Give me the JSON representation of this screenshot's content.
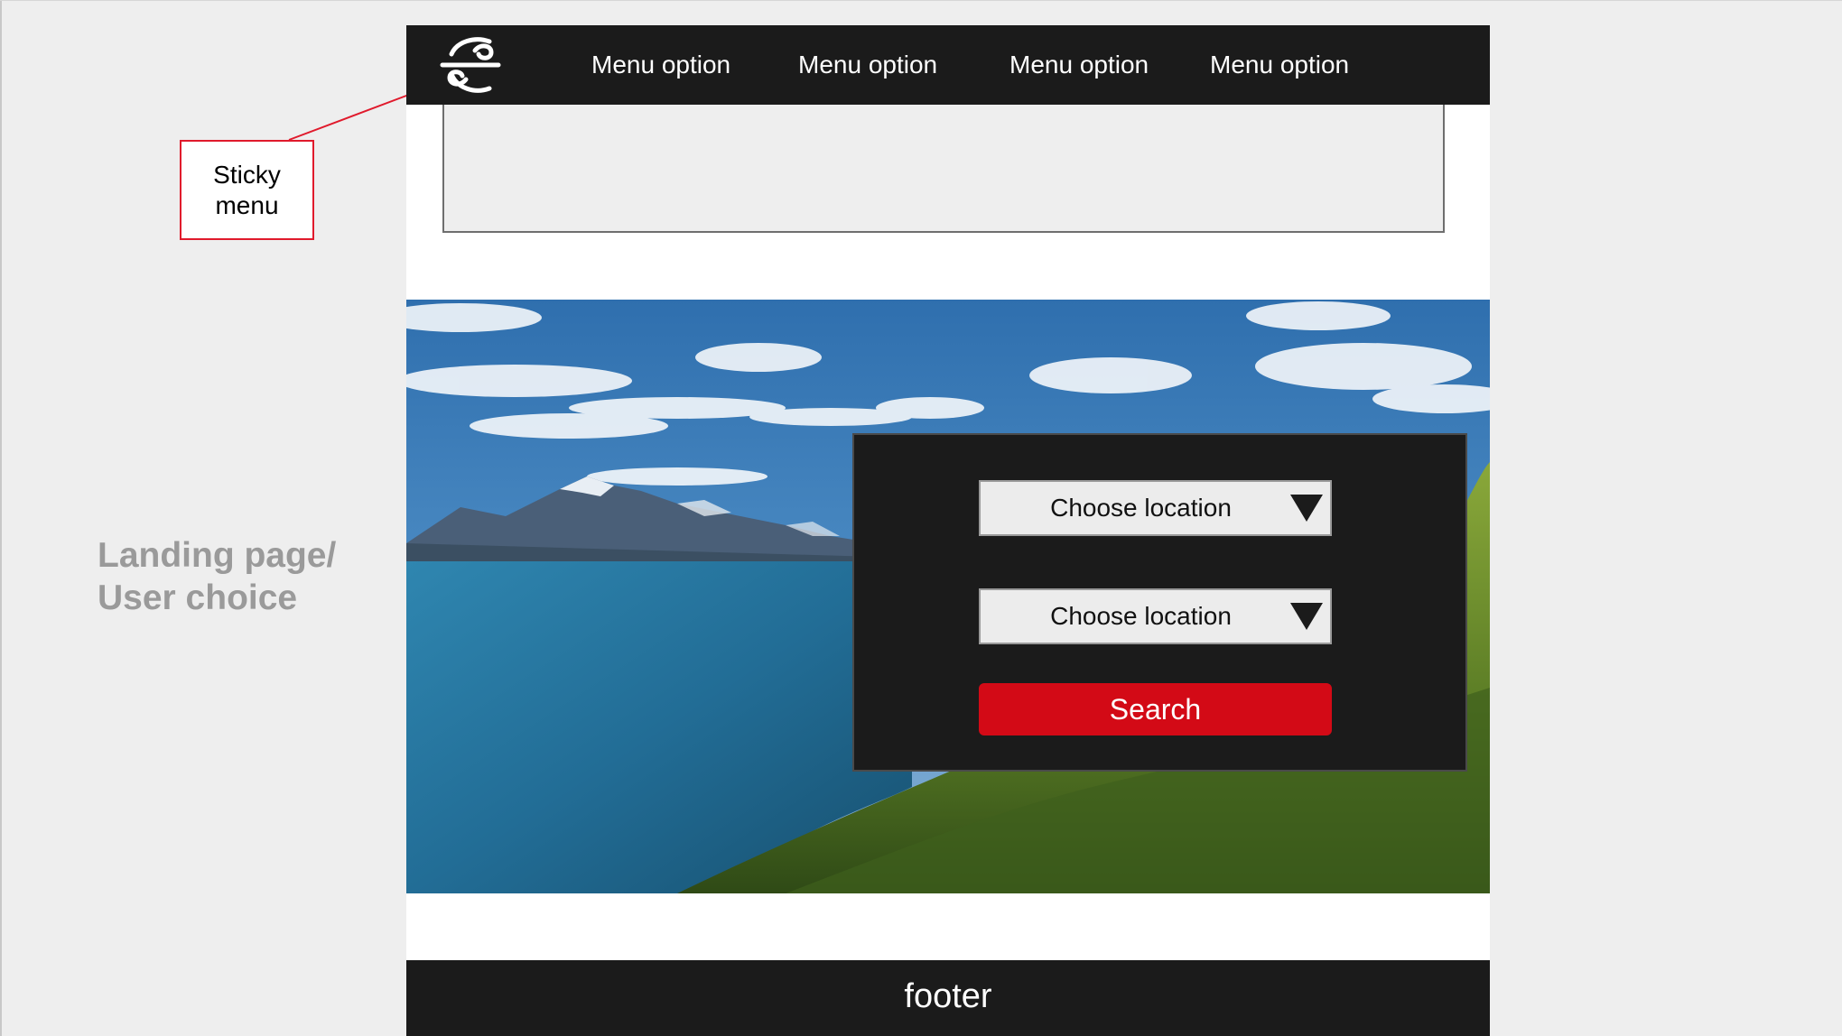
{
  "annotation": {
    "sticky_label": "Sticky\nmenu",
    "color": "#e01a2c"
  },
  "side_label": "Landing page/\nUser choice",
  "navbar": {
    "logo_icon": "koru-logo-icon",
    "menu_items": [
      "Menu option",
      "Menu option",
      "Menu option",
      "Menu option"
    ]
  },
  "search_panel": {
    "from_select": "Choose location",
    "to_select": "Choose location",
    "search_label": "Search",
    "accent_color": "#d30a16"
  },
  "footer": {
    "label": "footer"
  }
}
